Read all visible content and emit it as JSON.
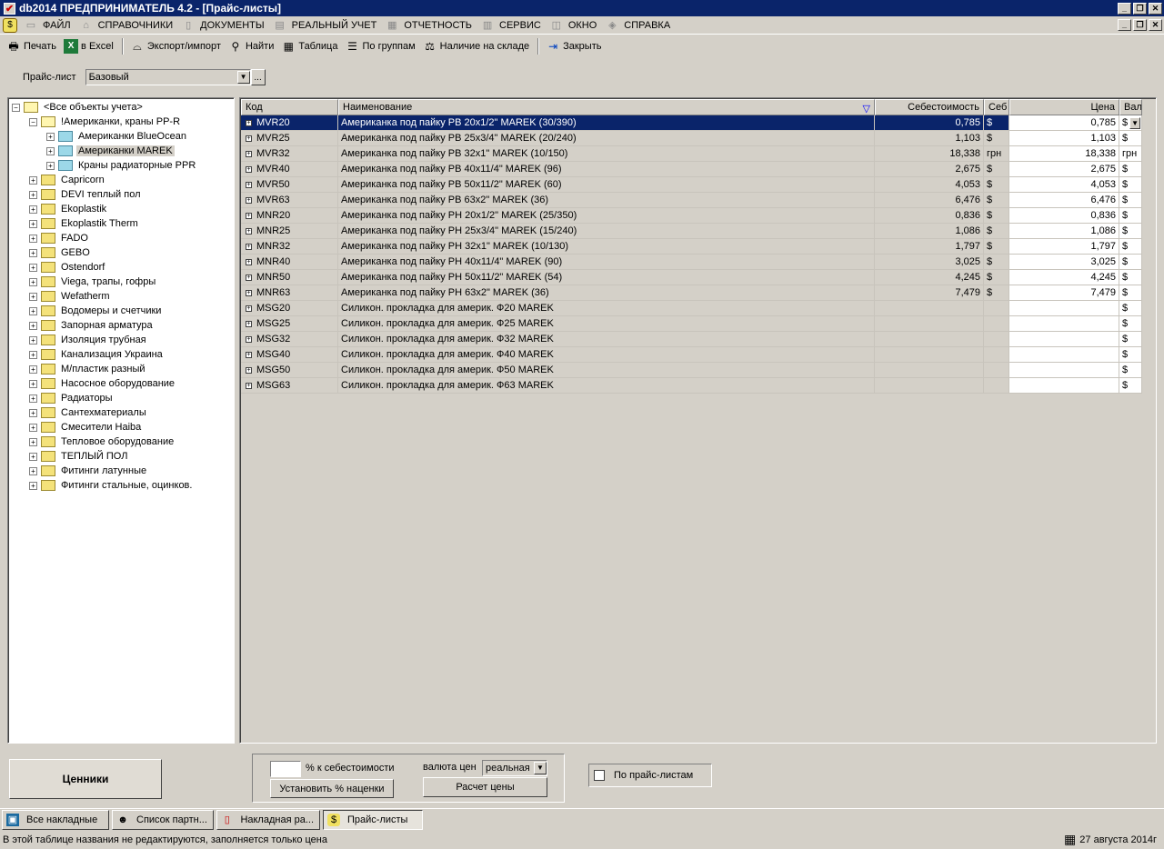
{
  "window": {
    "title": "db2014  ПРЕДПРИНИМАТЕЛЬ 4.2 - [Прайс-листы]"
  },
  "menu": [
    "ФАЙЛ",
    "СПРАВОЧНИКИ",
    "ДОКУМЕНТЫ",
    "РЕАЛЬНЫЙ УЧЕТ",
    "ОТЧЕТНОСТЬ",
    "СЕРВИС",
    "ОКНО",
    "СПРАВКА"
  ],
  "toolbar": {
    "print": "Печать",
    "excel": "в Excel",
    "export": "Экспорт/импорт",
    "find": "Найти",
    "table": "Таблица",
    "groups": "По группам",
    "stock": "Наличие на складе",
    "close": "Закрыть"
  },
  "pricelist": {
    "label": "Прайс-лист",
    "value": "Базовый",
    "more": "..."
  },
  "tree": [
    "<Все объекты учета>",
    "!Американки, краны PP-R",
    "Американки BlueOcean",
    "Американки MAREK",
    "Краны радиаторные PPR",
    "Capricorn",
    "DEVI теплый пол",
    "Ekoplastik",
    "Ekoplastik Therm",
    "FADO",
    "GEBO",
    "Ostendorf",
    "Viega, трапы, гофры",
    "Wefatherm",
    "Водомеры и счетчики",
    "Запорная арматура",
    "Изоляция трубная",
    "Канализация Украина",
    "М/пластик разный",
    "Насосное оборудование",
    "Радиаторы",
    "Сантехматериалы",
    "Смесители Haiba",
    "Тепловое оборудование",
    "ТЕПЛЫЙ ПОЛ",
    "Фитинги латунные",
    "Фитинги стальные, оцинков."
  ],
  "grid": {
    "headers": {
      "code": "Код",
      "name": "Наименование",
      "cost": "Себестоимость",
      "cost_cur": "Себ",
      "price": "Цена",
      "price_cur": "Вал"
    },
    "rows": [
      {
        "code": "MVR20",
        "name": "Американка под пайку РВ 20х1/2\" MAREK (30/390)",
        "cost": "0,785",
        "cost_cur": "$",
        "price": "0,785",
        "price_cur": "$"
      },
      {
        "code": "MVR25",
        "name": "Американка под пайку РВ 25х3/4\" MAREK (20/240)",
        "cost": "1,103",
        "cost_cur": "$",
        "price": "1,103",
        "price_cur": "$"
      },
      {
        "code": "MVR32",
        "name": "Американка под пайку РВ 32х1\" MAREK (10/150)",
        "cost": "18,338",
        "cost_cur": "грн",
        "price": "18,338",
        "price_cur": "грн"
      },
      {
        "code": "MVR40",
        "name": "Американка под пайку РВ 40х11/4\" MAREK (96)",
        "cost": "2,675",
        "cost_cur": "$",
        "price": "2,675",
        "price_cur": "$"
      },
      {
        "code": "MVR50",
        "name": "Американка под пайку РВ 50х11/2\" MAREK (60)",
        "cost": "4,053",
        "cost_cur": "$",
        "price": "4,053",
        "price_cur": "$"
      },
      {
        "code": "MVR63",
        "name": "Американка под пайку РВ 63х2\" MAREK (36)",
        "cost": "6,476",
        "cost_cur": "$",
        "price": "6,476",
        "price_cur": "$"
      },
      {
        "code": "MNR20",
        "name": "Американка под пайку РН 20х1/2\" MAREK (25/350)",
        "cost": "0,836",
        "cost_cur": "$",
        "price": "0,836",
        "price_cur": "$"
      },
      {
        "code": "MNR25",
        "name": "Американка под пайку РН 25х3/4\" MAREK (15/240)",
        "cost": "1,086",
        "cost_cur": "$",
        "price": "1,086",
        "price_cur": "$"
      },
      {
        "code": "MNR32",
        "name": "Американка под пайку РН 32х1\" MAREK (10/130)",
        "cost": "1,797",
        "cost_cur": "$",
        "price": "1,797",
        "price_cur": "$"
      },
      {
        "code": "MNR40",
        "name": "Американка под пайку РН 40х11/4\" MAREK (90)",
        "cost": "3,025",
        "cost_cur": "$",
        "price": "3,025",
        "price_cur": "$"
      },
      {
        "code": "MNR50",
        "name": "Американка под пайку РН 50х11/2\" MAREK (54)",
        "cost": "4,245",
        "cost_cur": "$",
        "price": "4,245",
        "price_cur": "$"
      },
      {
        "code": "MNR63",
        "name": "Американка под пайку РН 63х2\" MAREK (36)",
        "cost": "7,479",
        "cost_cur": "$",
        "price": "7,479",
        "price_cur": "$"
      },
      {
        "code": "MSG20",
        "name": "Силикон. прокладка для америк. Ф20 MAREK",
        "cost": "",
        "cost_cur": "",
        "price": "",
        "price_cur": "$"
      },
      {
        "code": "MSG25",
        "name": "Силикон. прокладка для америк. Ф25 MAREK",
        "cost": "",
        "cost_cur": "",
        "price": "",
        "price_cur": "$"
      },
      {
        "code": "MSG32",
        "name": "Силикон. прокладка для америк. Ф32 MAREK",
        "cost": "",
        "cost_cur": "",
        "price": "",
        "price_cur": "$"
      },
      {
        "code": "MSG40",
        "name": "Силикон. прокладка для америк. Ф40 MAREK",
        "cost": "",
        "cost_cur": "",
        "price": "",
        "price_cur": "$"
      },
      {
        "code": "MSG50",
        "name": "Силикон. прокладка для америк. Ф50 MAREK",
        "cost": "",
        "cost_cur": "",
        "price": "",
        "price_cur": "$"
      },
      {
        "code": "MSG63",
        "name": "Силикон. прокладка для америк. Ф63 MAREK",
        "cost": "",
        "cost_cur": "",
        "price": "",
        "price_cur": "$"
      }
    ]
  },
  "bottom": {
    "tsenniki": "Ценники",
    "percent_label": "% к себестоимости",
    "set_markup": "Установить % наценки",
    "currency_label": "валюта цен",
    "currency_value": "реальная",
    "calc": "Расчет цены",
    "by_pricelists": "По прайс-листам"
  },
  "tasks": [
    "Все накладные",
    "Список партн...",
    "Накладная ра...",
    "Прайс-листы"
  ],
  "status": {
    "message": "В этой таблице названия не редактируются, заполняется только цена",
    "date": "27 августа 2014г"
  },
  "colors": {
    "title_bg": "#0a246a",
    "selection": "#0a246a",
    "face": "#d4d0c8"
  }
}
